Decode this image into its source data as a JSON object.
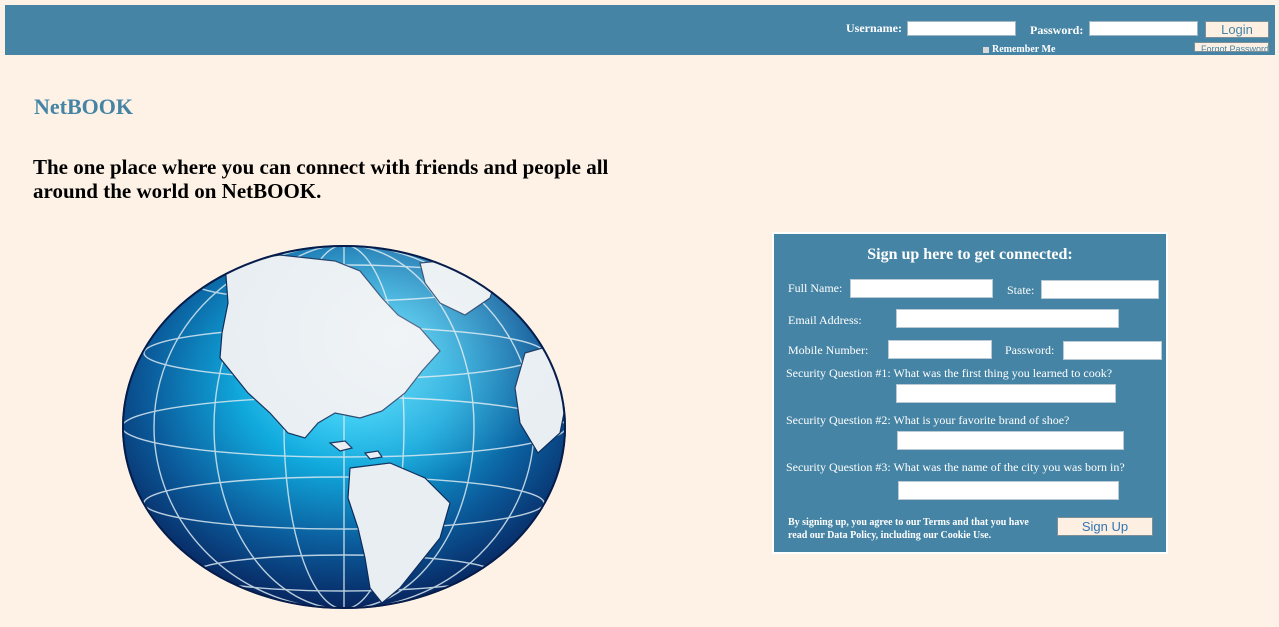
{
  "header": {
    "username_label": "Username:",
    "password_label": "Password:",
    "login_label": "Login",
    "remember_label": "Remember Me",
    "forgot_label": "Forgot Password"
  },
  "hero": {
    "brand": "NetBOOK",
    "tagline": "The one place where you can connect with friends and people all around the world on NetBOOK."
  },
  "signup": {
    "title": "Sign up here to get connected:",
    "full_name_label": "Full Name:",
    "state_label": "State:",
    "email_label": "Email Address:",
    "mobile_label": "Mobile Number:",
    "password_label": "Password:",
    "q1_label": "Security Question #1: What was the first thing you learned to cook?",
    "q2_label": "Security Question #2: What is your favorite brand of shoe?",
    "q3_label": "Security Question #3: What was the name of the city you was born in?",
    "terms": "By signing up, you agree to our Terms and that you have read our Data Policy, including our Cookie Use.",
    "button_label": "Sign Up"
  },
  "colors": {
    "accent": "#4584a5",
    "background": "#fef2e6",
    "button": "#fdf0e2"
  },
  "icons": {
    "globe": "globe-icon"
  }
}
